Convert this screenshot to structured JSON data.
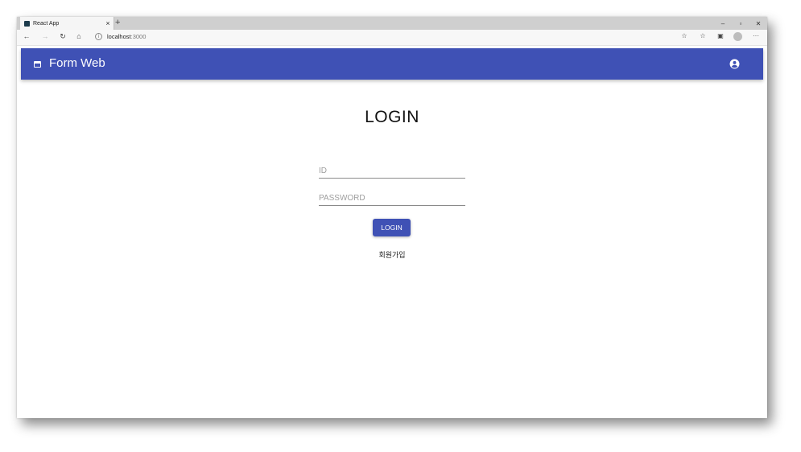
{
  "browser": {
    "tab_title": "React App",
    "tab_close": "×",
    "new_tab": "+",
    "window_controls": {
      "minimize": "–",
      "restore": "▫",
      "close": "✕"
    },
    "url_host": "localhost",
    "url_port": ":3000",
    "icons": [
      "back-icon",
      "forward-icon",
      "refresh-icon",
      "home-icon",
      "site-info-icon",
      "favorite-star-icon",
      "favorites-icon",
      "collections-icon",
      "profile-icon",
      "more-icon"
    ]
  },
  "app": {
    "title": "Form Web",
    "accent_color": "#3f51b5"
  },
  "login": {
    "heading": "LOGIN",
    "id_placeholder": "ID",
    "password_placeholder": "PASSWORD",
    "button_label": "LOGIN",
    "signup_label": "회원가입"
  }
}
